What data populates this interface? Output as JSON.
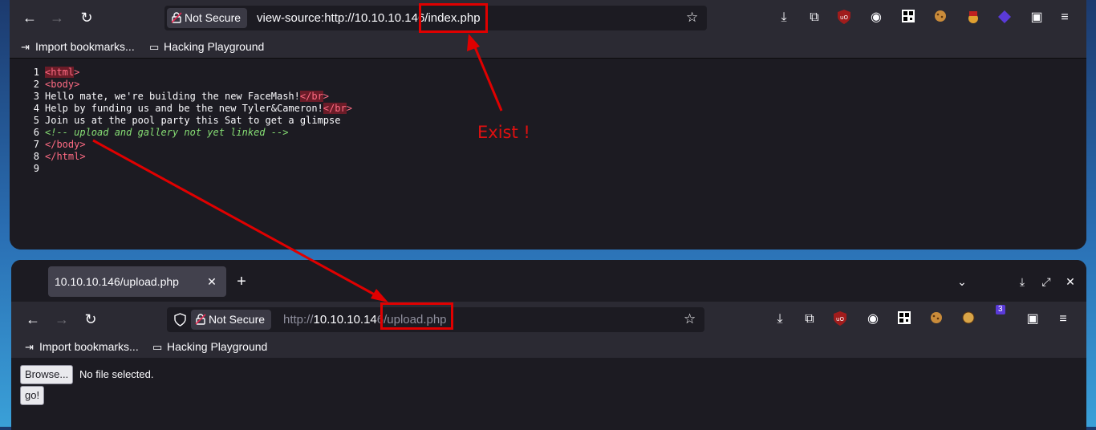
{
  "top_window": {
    "url_prefix": "view-source:http://10.10.10.14",
    "url_highlight": "6/index.php",
    "security_label": "Not Secure",
    "bookmarks": [
      {
        "label": "Import bookmarks..."
      },
      {
        "label": "Hacking Playground"
      }
    ],
    "source_lines": [
      {
        "num": "1"
      },
      {
        "num": "2"
      },
      {
        "num": "3",
        "text": "Hello mate, we're building the new FaceMash!"
      },
      {
        "num": "4",
        "text": "Help by funding us and be the new Tyler&Cameron!"
      },
      {
        "num": "5",
        "text": "Join us at the pool party this Sat to get a glimpse"
      },
      {
        "num": "6",
        "text": "<!-- upload and gallery not yet linked -->"
      },
      {
        "num": "7"
      },
      {
        "num": "8"
      },
      {
        "num": "9"
      }
    ],
    "tag_tokens": {
      "open_bracket": "<",
      "close_bracket": ">",
      "close_open": "</",
      "html": "html",
      "body": "body",
      "br": "br"
    },
    "annotation": "Exist !"
  },
  "bottom_window": {
    "tab_title": "10.10.10.146/upload.php",
    "url_scheme": "http://",
    "url_host": "10.10.10.14",
    "url_highlight": "6/upload.php",
    "security_label": "Not Secure",
    "bookmarks": [
      {
        "label": "Import bookmarks..."
      },
      {
        "label": "Hacking Playground"
      }
    ],
    "extension_badge": "3",
    "form": {
      "browse_label": "Browse...",
      "file_status": "No file selected.",
      "submit_label": "go!"
    }
  },
  "colors": {
    "annotation": "#e00000",
    "tag": "#ff6b83",
    "comment": "#86de74",
    "toolbar": "#2b2a33"
  },
  "icons": [
    "back-arrow-icon",
    "forward-arrow-icon",
    "reload-icon",
    "lock-icon",
    "star-icon",
    "download-icon",
    "extensions-icon",
    "ublock-icon",
    "user-agent-icon",
    "qr-icon",
    "cookie-icon",
    "hat-icon",
    "cube-icon",
    "screenshot-icon",
    "menu-icon",
    "shield-icon",
    "chevron-down-icon",
    "minimize-icon",
    "maximize-icon",
    "close-icon"
  ]
}
